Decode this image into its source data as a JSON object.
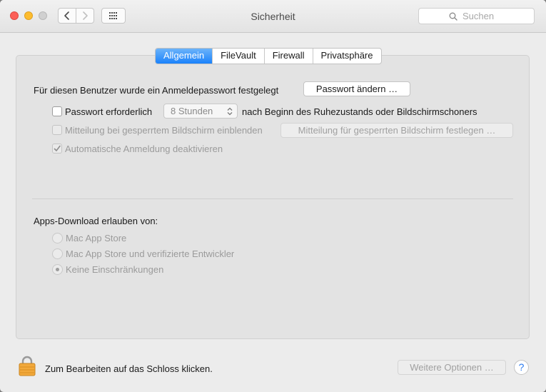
{
  "window": {
    "title": "Sicherheit",
    "search": {
      "placeholder": "Suchen",
      "value": ""
    }
  },
  "tabs": [
    {
      "label": "Allgemein",
      "active": true
    },
    {
      "label": "FileVault",
      "active": false
    },
    {
      "label": "Firewall",
      "active": false
    },
    {
      "label": "Privatsphäre",
      "active": false
    }
  ],
  "general": {
    "password_set_text": "Für diesen Benutzer wurde ein Anmeldepasswort festgelegt",
    "change_password_button": "Passwort ändern …",
    "require_password": {
      "label": "Passwort erforderlich",
      "checked": false
    },
    "require_delay_value": "8 Stunden",
    "require_suffix": "nach Beginn des Ruhezustands oder Bildschirmschoners",
    "lock_message": {
      "label": "Mitteilung bei gesperrtem Bildschirm einblenden",
      "checked": false,
      "enabled": false
    },
    "lock_message_button": "Mitteilung für gesperrten Bildschirm festlegen …",
    "auto_login": {
      "label": "Automatische Anmeldung deaktivieren",
      "checked": true,
      "enabled": false
    }
  },
  "apps_download": {
    "heading": "Apps-Download erlauben von:",
    "options": [
      {
        "label": "Mac App Store",
        "selected": false
      },
      {
        "label": "Mac App Store und verifizierte Entwickler",
        "selected": false
      },
      {
        "label": "Keine Einschränkungen",
        "selected": true
      }
    ]
  },
  "footer": {
    "lock_text": "Zum Bearbeiten auf das Schloss klicken.",
    "more_options_button": "Weitere Optionen …",
    "help_label": "?"
  },
  "colors": {
    "accent": "#1a82fb",
    "close": "#fc5f57",
    "minimize": "#fdbc2e",
    "lock": "#f2a93b"
  }
}
